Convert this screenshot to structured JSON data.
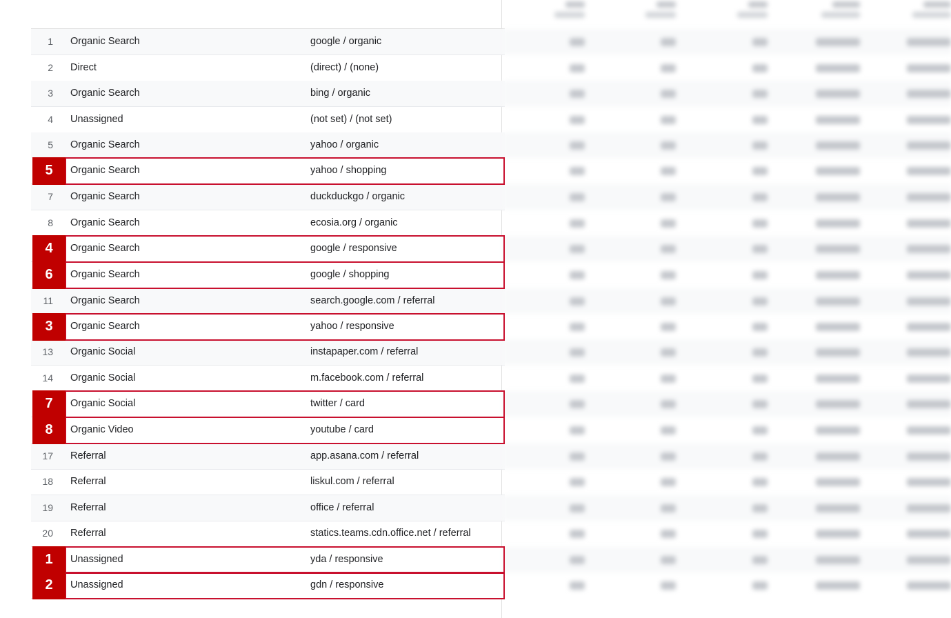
{
  "rows": [
    {
      "n": "1",
      "channel": "Organic Search",
      "source": "google / organic"
    },
    {
      "n": "2",
      "channel": "Direct",
      "source": "(direct) / (none)"
    },
    {
      "n": "3",
      "channel": "Organic Search",
      "source": "bing / organic"
    },
    {
      "n": "4",
      "channel": "Unassigned",
      "source": "(not set) / (not set)"
    },
    {
      "n": "5",
      "channel": "Organic Search",
      "source": "yahoo / organic"
    },
    {
      "n": "5",
      "channel": "Organic Search",
      "source": "yahoo / shopping",
      "highlight": true
    },
    {
      "n": "7",
      "channel": "Organic Search",
      "source": "duckduckgo / organic"
    },
    {
      "n": "8",
      "channel": "Organic Search",
      "source": "ecosia.org / organic"
    },
    {
      "n": "4",
      "channel": "Organic Search",
      "source": "google / responsive",
      "highlight": true
    },
    {
      "n": "6",
      "channel": "Organic Search",
      "source": "google / shopping",
      "highlight": true
    },
    {
      "n": "11",
      "channel": "Organic Search",
      "source": "search.google.com / referral"
    },
    {
      "n": "3",
      "channel": "Organic Search",
      "source": "yahoo / responsive",
      "highlight": true
    },
    {
      "n": "13",
      "channel": "Organic Social",
      "source": "instapaper.com / referral"
    },
    {
      "n": "14",
      "channel": "Organic Social",
      "source": "m.facebook.com / referral"
    },
    {
      "n": "7",
      "channel": "Organic Social",
      "source": "twitter / card",
      "highlight": true
    },
    {
      "n": "8",
      "channel": "Organic Video",
      "source": "youtube / card",
      "highlight": true
    },
    {
      "n": "17",
      "channel": "Referral",
      "source": "app.asana.com / referral"
    },
    {
      "n": "18",
      "channel": "Referral",
      "source": "liskul.com / referral"
    },
    {
      "n": "19",
      "channel": "Referral",
      "source": "office / referral"
    },
    {
      "n": "20",
      "channel": "Referral",
      "source": "statics.teams.cdn.office.net / referral"
    },
    {
      "n": "1",
      "channel": "Unassigned",
      "source": "yda / responsive",
      "highlight": true
    },
    {
      "n": "2",
      "channel": "Unassigned",
      "source": "gdn / responsive",
      "highlight": true
    }
  ],
  "colors": {
    "highlight_border": "#c8102e",
    "badge_bg": "#c00000",
    "alt_row_bg": "#f8f9fa"
  }
}
